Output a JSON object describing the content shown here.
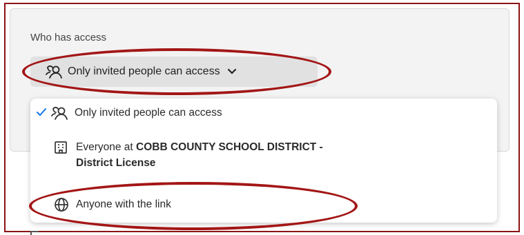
{
  "section": {
    "label": "Who has access"
  },
  "dropdown": {
    "selected": "Only invited people can access",
    "icon": "people-icon",
    "chevron": "chevron-down-icon"
  },
  "menu": {
    "items": [
      {
        "label": "Only invited people can access",
        "icon": "people-icon",
        "selected": true
      },
      {
        "label_prefix": "Everyone at ",
        "label_bold_1": "COBB COUNTY SCHOOL DISTRICT -",
        "label_bold_2": "District License",
        "icon": "building-icon",
        "selected": false
      },
      {
        "label": "Anyone with the link",
        "icon": "globe-icon",
        "selected": false
      }
    ]
  },
  "colors": {
    "annotation": "#a31616",
    "check": "#1473e6",
    "panel": "#f3f3f3",
    "dropdown": "#e1e1e1"
  }
}
